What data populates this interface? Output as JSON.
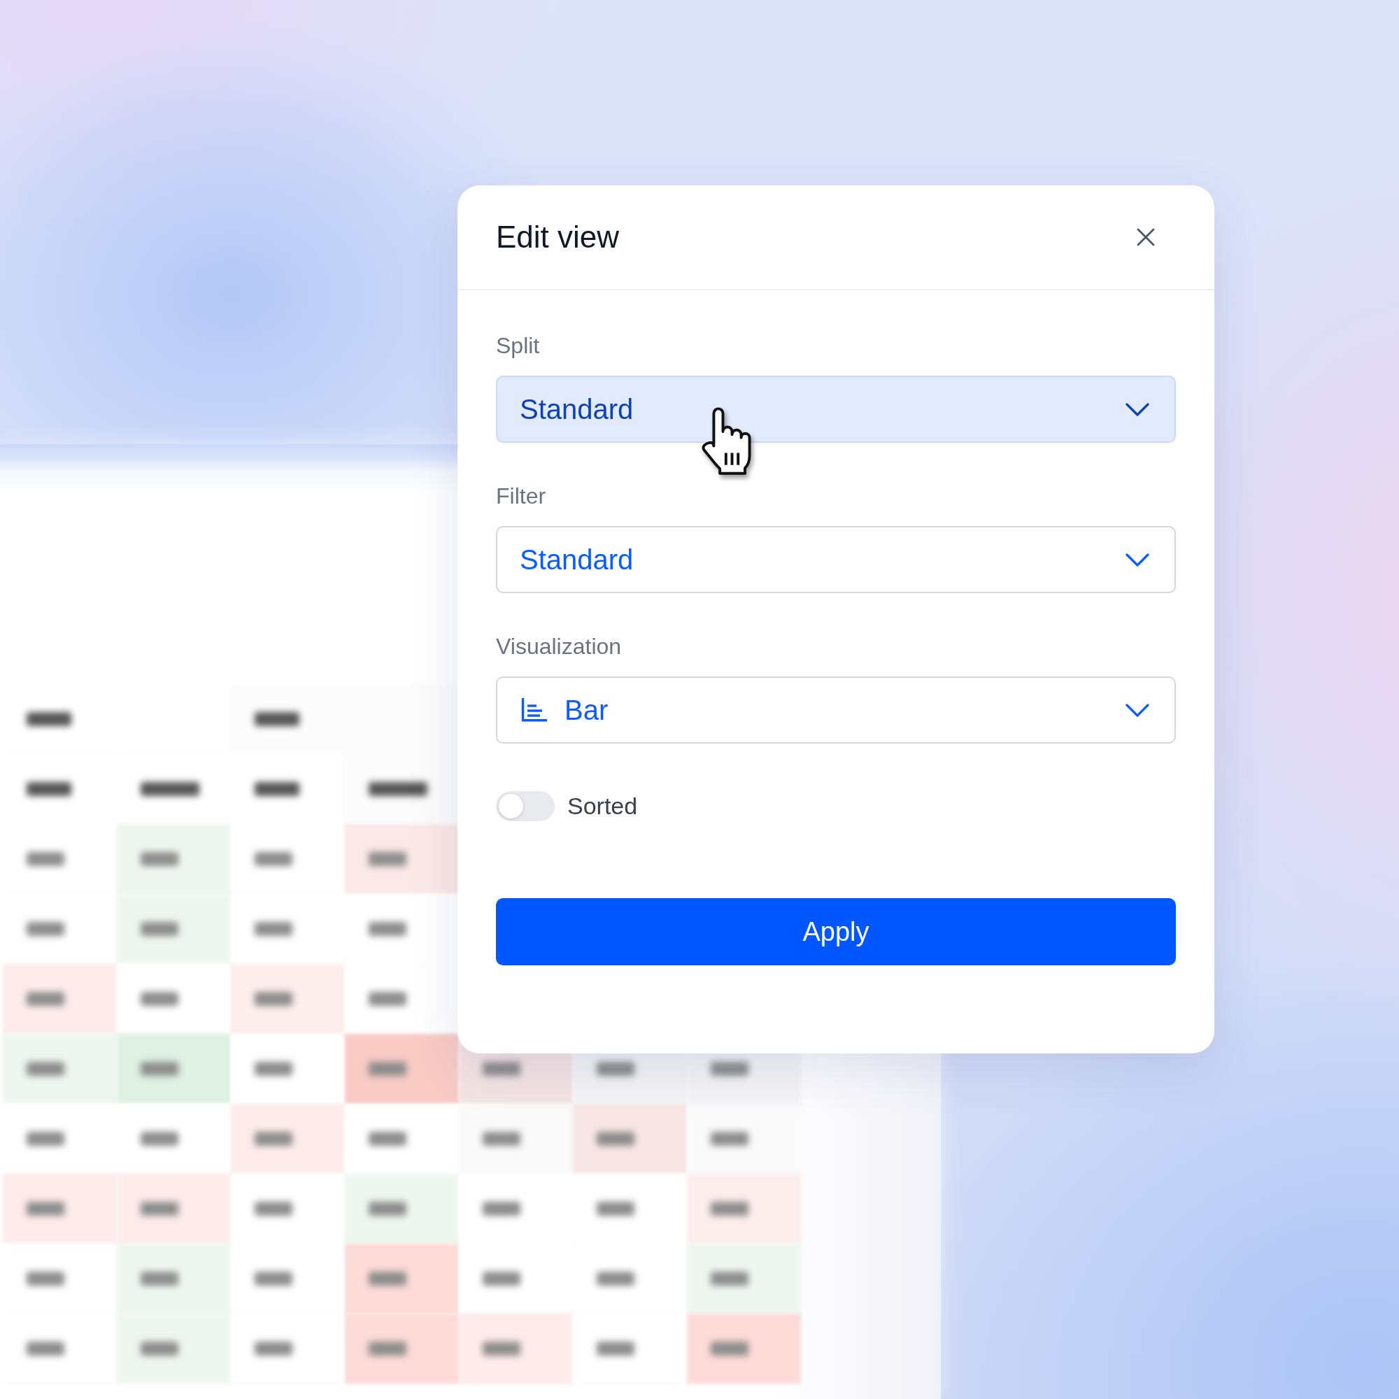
{
  "dialog": {
    "title": "Edit view",
    "fields": [
      {
        "kind": "select",
        "label": "Split",
        "value": "Standard",
        "hovered": true
      },
      {
        "kind": "select",
        "label": "Filter",
        "value": "Standard",
        "hovered": false
      },
      {
        "kind": "chart",
        "label": "Visualization",
        "value": "Bar",
        "hovered": false
      }
    ],
    "toggle": {
      "label": "Sorted",
      "on": false
    },
    "apply_button": {
      "label": "Apply"
    }
  },
  "background_table": {
    "rows": [
      {
        "kind": "group",
        "cells": [
          {
            "color": "#ffffff"
          },
          {
            "color": "#fcfcfc"
          }
        ]
      },
      {
        "kind": "header",
        "cells": [
          {
            "color": "#ffffff"
          },
          {
            "color": "#ffffff"
          },
          {
            "color": "#ffffff"
          },
          {
            "color": "#fcfcfc"
          }
        ]
      },
      {
        "kind": "data",
        "cells": [
          {
            "color": "#ffffff"
          },
          {
            "color": "#eef7ef"
          },
          {
            "color": "#ffffff"
          },
          {
            "color": "#fbe8e7"
          }
        ]
      },
      {
        "kind": "data",
        "cells": [
          {
            "color": "#ffffff"
          },
          {
            "color": "#eef7ef"
          },
          {
            "color": "#ffffff"
          },
          {
            "color": "#ffffff"
          }
        ]
      },
      {
        "kind": "data",
        "cells": [
          {
            "color": "#fdeceb"
          },
          {
            "color": "#ffffff"
          },
          {
            "color": "#fdeeed"
          },
          {
            "color": "#ffffff"
          }
        ]
      },
      {
        "kind": "data",
        "cells": [
          {
            "color": "#eef7ef"
          },
          {
            "color": "#dff2e4"
          },
          {
            "color": "#ffffff"
          },
          {
            "color": "#f9cbc5"
          },
          {
            "color": "#f4e4e3"
          },
          {
            "color": "#f4f4f5"
          },
          {
            "color": "#f4f4f5"
          }
        ]
      },
      {
        "kind": "data",
        "cells": [
          {
            "color": "#ffffff"
          },
          {
            "color": "#ffffff"
          },
          {
            "color": "#fdeceb"
          },
          {
            "color": "#ffffff"
          },
          {
            "color": "#fafafa"
          },
          {
            "color": "#f8e6e4"
          },
          {
            "color": "#fafafa"
          }
        ]
      },
      {
        "kind": "data",
        "cells": [
          {
            "color": "#fdeceb"
          },
          {
            "color": "#fdeceb"
          },
          {
            "color": "#ffffff"
          },
          {
            "color": "#eef7ef"
          },
          {
            "color": "#ffffff"
          },
          {
            "color": "#ffffff"
          },
          {
            "color": "#fdeeed"
          }
        ]
      },
      {
        "kind": "data",
        "cells": [
          {
            "color": "#ffffff"
          },
          {
            "color": "#eef7ef"
          },
          {
            "color": "#ffffff"
          },
          {
            "color": "#fddbd8"
          },
          {
            "color": "#ffffff"
          },
          {
            "color": "#ffffff"
          },
          {
            "color": "#eef7ef"
          }
        ]
      },
      {
        "kind": "data",
        "cells": [
          {
            "color": "#ffffff"
          },
          {
            "color": "#eef7ef"
          },
          {
            "color": "#ffffff"
          },
          {
            "color": "#fddbd8"
          },
          {
            "color": "#fdecea"
          },
          {
            "color": "#ffffff"
          },
          {
            "color": "#fddbd8"
          }
        ]
      }
    ]
  }
}
